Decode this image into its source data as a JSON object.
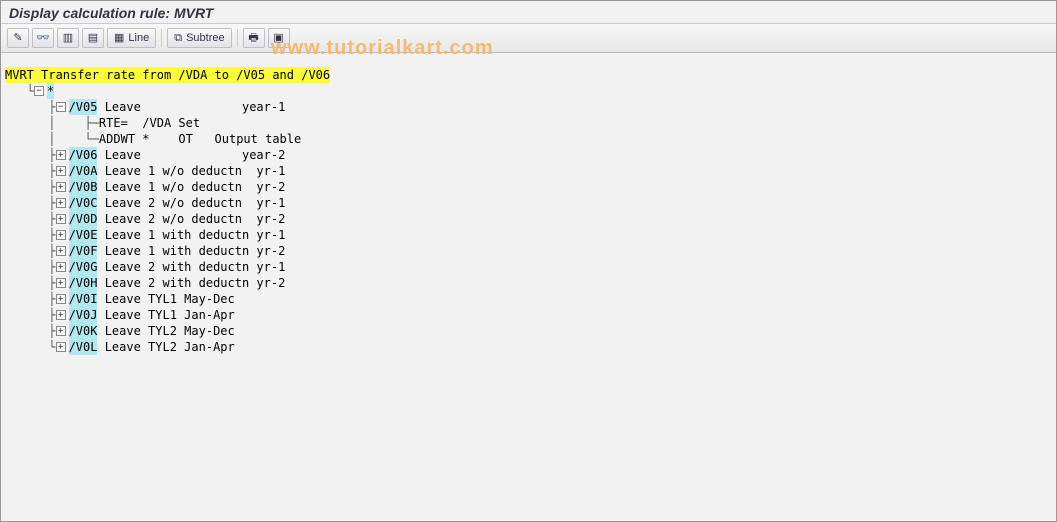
{
  "title": "Display calculation rule: MVRT",
  "toolbar": {
    "line_label": "Line",
    "subtree_label": "Subtree"
  },
  "watermark": "www.tutorialkart.com",
  "tree": {
    "root_code": "MVRT",
    "root_desc": " Transfer rate from /VDA to /V05 and /V06",
    "star_label": "*",
    "items": [
      {
        "code": "/V05",
        "desc": " Leave              year-1",
        "expanded": true,
        "children": [
          {
            "text": "RTE=  /VDA Set"
          },
          {
            "text": "ADDWT *    OT   Output table"
          }
        ]
      },
      {
        "code": "/V06",
        "desc": " Leave              year-2"
      },
      {
        "code": "/V0A",
        "desc": " Leave 1 w/o deductn  yr-1"
      },
      {
        "code": "/V0B",
        "desc": " Leave 1 w/o deductn  yr-2"
      },
      {
        "code": "/V0C",
        "desc": " Leave 2 w/o deductn  yr-1"
      },
      {
        "code": "/V0D",
        "desc": " Leave 2 w/o deductn  yr-2"
      },
      {
        "code": "/V0E",
        "desc": " Leave 1 with deductn yr-1"
      },
      {
        "code": "/V0F",
        "desc": " Leave 1 with deductn yr-2"
      },
      {
        "code": "/V0G",
        "desc": " Leave 2 with deductn yr-1"
      },
      {
        "code": "/V0H",
        "desc": " Leave 2 with deductn yr-2"
      },
      {
        "code": "/V0I",
        "desc": " Leave TYL1 May-Dec"
      },
      {
        "code": "/V0J",
        "desc": " Leave TYL1 Jan-Apr"
      },
      {
        "code": "/V0K",
        "desc": " Leave TYL2 May-Dec"
      },
      {
        "code": "/V0L",
        "desc": " Leave TYL2 Jan-Apr"
      }
    ]
  },
  "icons": {
    "pencil": "✎",
    "glasses": "👓",
    "box1": "▥",
    "box2": "▤",
    "grid": "▦",
    "tree": "⧉",
    "print": "🖶",
    "layers": "▣"
  }
}
